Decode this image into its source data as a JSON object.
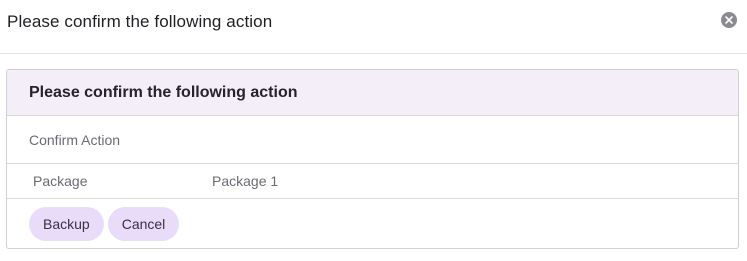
{
  "modal": {
    "title": "Please confirm the following action",
    "close_icon": "close-icon"
  },
  "panel": {
    "title": "Please confirm the following action",
    "section_label": "Confirm Action",
    "rows": [
      {
        "key": "Package",
        "value": "Package 1"
      }
    ],
    "buttons": {
      "backup": "Backup",
      "cancel": "Cancel"
    }
  },
  "colors": {
    "panel_header_bg": "#f4eef8",
    "button_bg": "#e8dcf9",
    "close_icon_bg": "#8a8a8f"
  }
}
